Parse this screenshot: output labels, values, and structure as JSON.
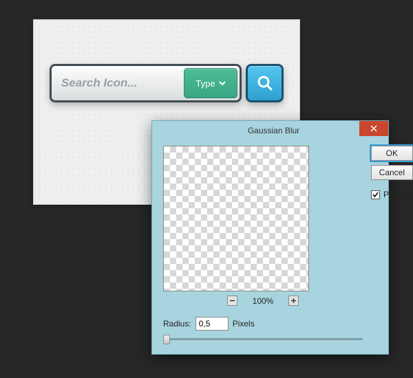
{
  "search": {
    "placeholder": "Search Icon...",
    "type_label": "Type"
  },
  "dialog": {
    "title": "Gaussian Blur",
    "ok_label": "OK",
    "cancel_label": "Cancel",
    "preview_label": "Preview",
    "preview_checked": true,
    "zoom_value": "100%",
    "radius_label": "Radius:",
    "radius_value": "0,5",
    "radius_unit": "Pixels"
  }
}
